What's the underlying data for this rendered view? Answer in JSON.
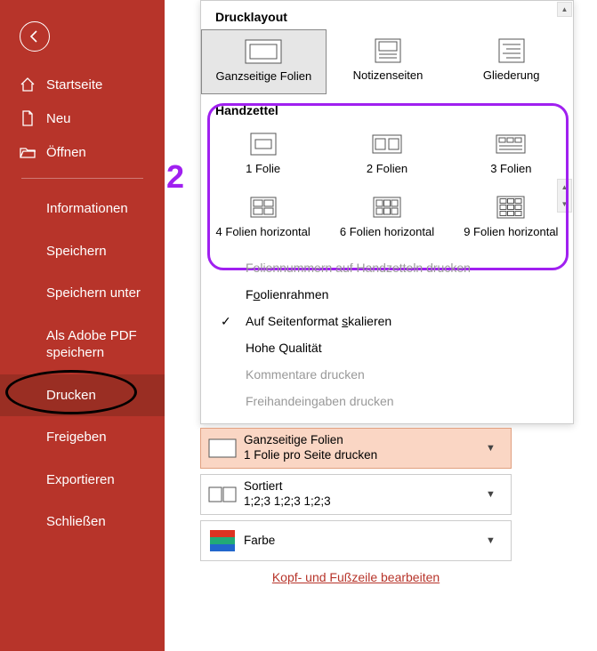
{
  "sidebar": {
    "items": [
      {
        "label": "Startseite"
      },
      {
        "label": "Neu"
      },
      {
        "label": "Öffnen"
      }
    ],
    "subs": [
      {
        "label": "Informationen"
      },
      {
        "label": "Speichern"
      },
      {
        "label": "Speichern unter"
      },
      {
        "label": "Als Adobe PDF speichern"
      },
      {
        "label": "Drucken",
        "active": true
      },
      {
        "label": "Freigeben"
      },
      {
        "label": "Exportieren"
      },
      {
        "label": "Schließen"
      }
    ]
  },
  "annotation": {
    "step": "2"
  },
  "dropdown": {
    "section_print_layout": "Drucklayout",
    "layout": [
      {
        "label": "Ganzseitige Folien",
        "selected": true
      },
      {
        "label": "Notizenseiten"
      },
      {
        "label": "Gliederung"
      }
    ],
    "section_handout": "Handzettel",
    "handout_row1": [
      {
        "label": "1 Folie"
      },
      {
        "label": "2 Folien"
      },
      {
        "label": "3 Folien"
      }
    ],
    "handout_row2": [
      {
        "label": "4 Folien horizontal"
      },
      {
        "label": "6 Folien horizontal"
      },
      {
        "label": "9 Folien horizontal"
      }
    ],
    "opts": {
      "nums": "Foliennummern auf Handzetteln drucken",
      "frame": "olienrahmen",
      "scale": "kalieren",
      "scale_prefix": "Auf Seitenformat ",
      "hq": "Hohe Qualität",
      "comments": "Kommentare drucken",
      "ink": "Freihandeingaben drucken"
    }
  },
  "settings": {
    "layout": {
      "line1": "Ganzseitige Folien",
      "line2": "1 Folie pro Seite drucken"
    },
    "collate": {
      "line1": "Sortiert",
      "line2": "1;2;3   1;2;3   1;2;3"
    },
    "color": {
      "line1": "Farbe"
    }
  },
  "footer_link": "Kopf- und Fußzeile bearbeiten"
}
